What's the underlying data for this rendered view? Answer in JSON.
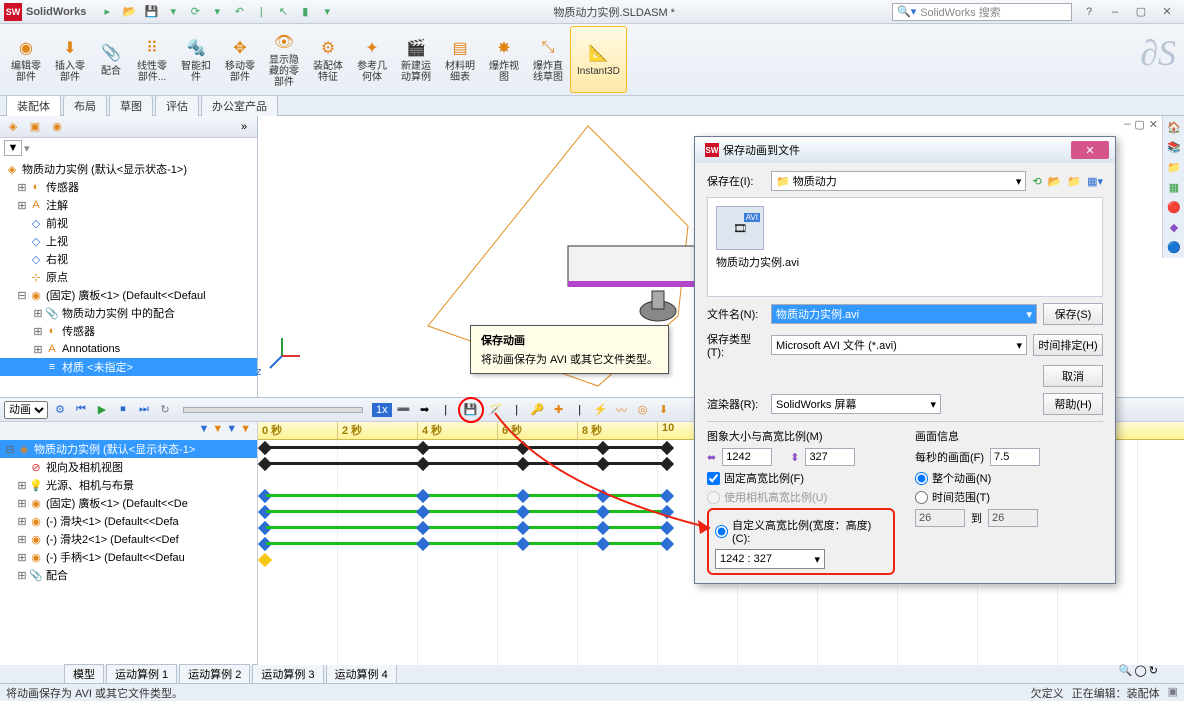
{
  "titlebar": {
    "brand": "SolidWorks",
    "document": "物质动力实例.SLDASM *",
    "search_placeholder": "SolidWorks 搜索"
  },
  "ribbon": {
    "items": [
      {
        "label": "编辑零\n部件"
      },
      {
        "label": "插入零\n部件"
      },
      {
        "label": "配合"
      },
      {
        "label": "线性零\n部件..."
      },
      {
        "label": "智能扣\n件"
      },
      {
        "label": "移动零\n部件"
      },
      {
        "label": "显示隐\n藏的零\n部件"
      },
      {
        "label": "装配体\n特征"
      },
      {
        "label": "参考几\n何体"
      },
      {
        "label": "新建运\n动算例"
      },
      {
        "label": "材料明\n细表"
      },
      {
        "label": "爆炸视\n图"
      },
      {
        "label": "爆炸直\n线草图"
      },
      {
        "label": "Instant3D"
      }
    ]
  },
  "tabs": [
    "装配体",
    "布局",
    "草图",
    "评估",
    "办公室产品"
  ],
  "tree": {
    "root": "物质动力实例  (默认<显示状态-1>)",
    "items": [
      {
        "icon": "sensor",
        "label": "传感器"
      },
      {
        "icon": "note",
        "label": "注解"
      },
      {
        "icon": "plane",
        "label": "前视"
      },
      {
        "icon": "plane",
        "label": "上视"
      },
      {
        "icon": "plane",
        "label": "右视"
      },
      {
        "icon": "origin",
        "label": "原点"
      },
      {
        "icon": "part",
        "label": "(固定) 廣板<1> (Default<<Defaul"
      },
      {
        "icon": "mate",
        "label": "物质动力实例 中的配合",
        "ind": 2
      },
      {
        "icon": "sensor",
        "label": "传感器",
        "ind": 2
      },
      {
        "icon": "note",
        "label": "Annotations",
        "ind": 2
      },
      {
        "icon": "mat",
        "label": "材质 <未指定>",
        "ind": 2,
        "sel": true
      }
    ]
  },
  "tooltip": {
    "title": "保存动画",
    "body": "将动画保存为 AVI 或其它文件类型。"
  },
  "motion": {
    "dropdown": "动画",
    "speed": "1x",
    "ticks": [
      "0 秒",
      "2 秒",
      "4 秒",
      "6 秒",
      "8 秒",
      "10"
    ],
    "tree": [
      {
        "label": "物质动力实例 (默认<显示状态-1>",
        "sel": true
      },
      {
        "label": "视向及相机视图"
      },
      {
        "label": "光源、相机与布景"
      },
      {
        "label": "(固定) 廣板<1> (Default<<De"
      },
      {
        "label": "(-) 滑块<1> (Default<<Defa"
      },
      {
        "label": "(-) 滑块2<1> (Default<<Def"
      },
      {
        "label": "(-) 手柄<1> (Default<<Defau"
      },
      {
        "label": "配合"
      }
    ],
    "tabs": [
      "模型",
      "运动算例 1",
      "运动算例 2",
      "运动算例 3",
      "运动算例 4"
    ]
  },
  "status": {
    "left": "将动画保存为 AVI 或其它文件类型。",
    "right1": "欠定义",
    "right2": "正在编辑：装配体"
  },
  "dialog": {
    "title": "保存动画到文件",
    "savein_label": "保存在(I):",
    "savein_value": "物质动力",
    "thumbnail_name": "物质动力实例.avi",
    "filename_label": "文件名(N):",
    "filename_value": "物质动力实例.avi",
    "filetype_label": "保存类型(T):",
    "filetype_value": "Microsoft AVI 文件 (*.avi)",
    "renderer_label": "渲染器(R):",
    "renderer_value": "SolidWorks 屏幕",
    "save_btn": "保存(S)",
    "schedule_btn": "时间排定(H)",
    "cancel_btn": "取消",
    "help_btn": "帮助(H)",
    "size_section": "图象大小与高宽比例(M)",
    "width": "1242",
    "height": "327",
    "fixratio": "固定高宽比例(F)",
    "usecamera": "使用相机高宽比例(U)",
    "custom": "自定义高宽比例(宽度：高度)(C):",
    "ratio": "1242 : 327",
    "info_section": "画面信息",
    "fps_label": "每秒的画面(F)",
    "fps_value": "7.5",
    "whole": "整个动画(N)",
    "range": "时间范围(T)",
    "range_from": "26",
    "range_to_lbl": "到",
    "range_to": "26"
  },
  "triad": {
    "z": "z"
  }
}
